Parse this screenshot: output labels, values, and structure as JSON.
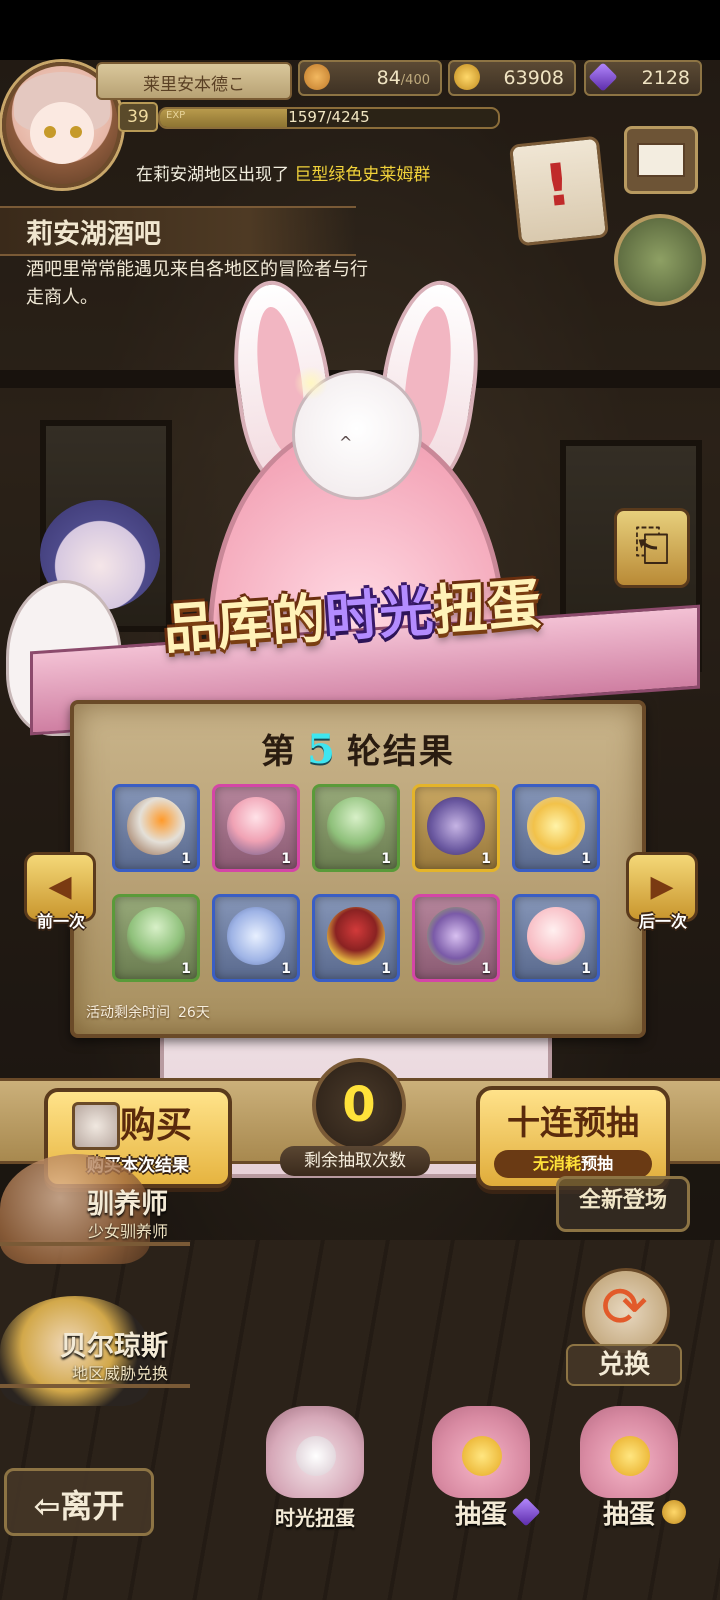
{
  "player": {
    "name": "莱里安本德こ",
    "level": "39",
    "exp_label": "EXP",
    "exp_text": "1597/4245",
    "exp_fraction": 0.376
  },
  "resources": {
    "stamina": "84",
    "stamina_max": "/400",
    "gold": "63908",
    "gems": "2128"
  },
  "announcement": {
    "prefix": "在莉安湖地区出现了",
    "highlight": "巨型绿色史莱姆群"
  },
  "location": {
    "title": "莉安湖酒吧",
    "description": "酒吧里常常能遇见来自各地区的冒险者与行走商人。"
  },
  "gacha": {
    "title_pre": "品库的",
    "title_hl": "时光",
    "title_post": "扭蛋",
    "round_pre": "第",
    "round_num": "5",
    "round_post": "轮结果",
    "remaining_time_label": "活动剩余时间",
    "remaining_time_value": "26天",
    "prev_label": "前一次",
    "next_label": "后一次",
    "items": [
      {
        "name": "flame-torch-icon",
        "qty": "1",
        "rarity": "blue"
      },
      {
        "name": "pink-egg-nest-icon",
        "qty": "1",
        "rarity": "pink"
      },
      {
        "name": "green-egg-icon",
        "qty": "1",
        "rarity": "green"
      },
      {
        "name": "pocket-watch-icon",
        "qty": "1",
        "rarity": "gold"
      },
      {
        "name": "sun-amulet-icon",
        "qty": "1",
        "rarity": "blue"
      },
      {
        "name": "green-egg-icon",
        "qty": "1",
        "rarity": "green"
      },
      {
        "name": "crystal-gem-icon",
        "qty": "1",
        "rarity": "blue"
      },
      {
        "name": "berry-leaf-icon",
        "qty": "1",
        "rarity": "blue"
      },
      {
        "name": "winged-egg-icon",
        "qty": "1",
        "rarity": "pink"
      },
      {
        "name": "peach-icon",
        "qty": "1",
        "rarity": "blue"
      }
    ]
  },
  "actions": {
    "buy_label": "购买",
    "buy_sub": "购买本次结果",
    "remaining_count": "0",
    "remaining_count_label": "剩余抽取次数",
    "ten_pull_label": "十连预抽",
    "ten_pull_sub_hl": "无消耗",
    "ten_pull_sub": "预抽"
  },
  "npcs": [
    {
      "name": "驯养师",
      "role": "少女驯养师"
    },
    {
      "name": "贝尔琼斯",
      "role": "地区威胁兑换"
    }
  ],
  "menu": {
    "new_badge": "全新登场",
    "exchange": "兑换",
    "leave": "离开",
    "time_gacha": "时光扭蛋",
    "egg_gem": "抽蛋",
    "egg_gold": "抽蛋"
  },
  "colors": {
    "gold": "#e8b23a",
    "gem": "#7a3ed8",
    "stamina": "#e09a3a",
    "round_num": "#3fe6f0",
    "count": "#ffe23a"
  }
}
